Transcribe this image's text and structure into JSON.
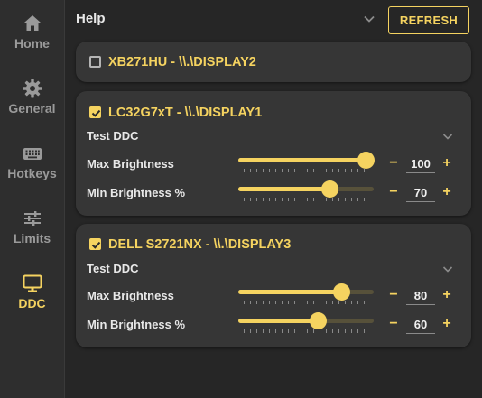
{
  "sidebar": {
    "items": [
      {
        "label": "Home",
        "icon": "home-icon"
      },
      {
        "label": "General",
        "icon": "gear-icon"
      },
      {
        "label": "Hotkeys",
        "icon": "keyboard-icon"
      },
      {
        "label": "Limits",
        "icon": "sliders-icon"
      },
      {
        "label": "DDC",
        "icon": "monitor-icon",
        "active": true
      }
    ]
  },
  "header": {
    "help_label": "Help",
    "refresh_label": "REFRESH"
  },
  "colors": {
    "accent": "#f5d360",
    "background": "#262626",
    "card": "#363636"
  },
  "monitors": [
    {
      "title": "XB271HU - \\\\.\\DISPLAY2",
      "checked": false
    },
    {
      "title": "LC32G7xT - \\\\.\\DISPLAY1",
      "checked": true,
      "ddc_label": "Test DDC",
      "max_label": "Max Brightness",
      "max_value": "100",
      "min_label": "Min Brightness %",
      "min_value": "70"
    },
    {
      "title": "DELL S2721NX - \\\\.\\DISPLAY3",
      "checked": true,
      "ddc_label": "Test DDC",
      "max_label": "Max Brightness",
      "max_value": "80",
      "min_label": "Min Brightness %",
      "min_value": "60"
    }
  ],
  "symbols": {
    "minus": "−",
    "plus": "+"
  }
}
